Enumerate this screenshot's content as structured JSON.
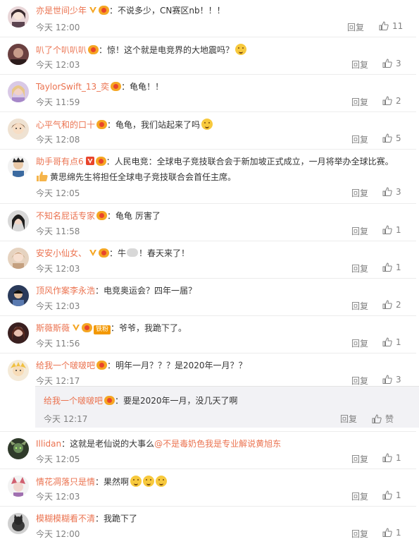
{
  "reply_label": "回复",
  "comments": [
    {
      "nick": "亦是世间少年",
      "text": "：不说多少，CN赛区nb！！！",
      "time": "今天 12:00",
      "likes": "11"
    },
    {
      "nick": "叭了个叭叭叭",
      "text": "：惊！这个就是电竞界的大地震吗？",
      "time": "今天 12:03",
      "likes": "3"
    },
    {
      "nick": "TaylorSwift_13_奕",
      "text": "：龟龟！！",
      "time": "今天 11:59",
      "likes": "2"
    },
    {
      "nick": "心平气和的口十",
      "text": "：龟龟，我们站起来了吗",
      "time": "今天 12:08",
      "likes": "5"
    },
    {
      "nick": "助手哥有点6",
      "text": "：人民电竞：全球电子竞技联合会于新加坡正式成立，一月将举办全球比赛。",
      "text2": "黄思绵先生将担任全球电子竞技联合会首任主席。",
      "time": "今天 12:05",
      "likes": "3"
    },
    {
      "nick": "不知名屁话专家",
      "text": "：龟龟 厉害了",
      "time": "今天 11:58",
      "likes": "1"
    },
    {
      "nick": "安安小仙女、",
      "text_a": "：牛",
      "text_b": "！春天来了！",
      "time": "今天 12:03",
      "likes": "1"
    },
    {
      "nick": "顶风作案李永浩",
      "text": "：电竞奥运会？四年一届？",
      "time": "今天 12:03",
      "likes": "2"
    },
    {
      "nick": "斯薇斯薇",
      "badge": "铁粉",
      "text": "：爷爷，我跪下了。",
      "time": "今天 11:56",
      "likes": "1"
    },
    {
      "nick": "给我一个啵啵吧",
      "text": "：明年一月？？？是2020年一月？？",
      "time": "今天 12:17",
      "likes": "3"
    },
    {
      "nick": "Illidan",
      "text_pre": "：这就是老仙说的大事么",
      "mention": "@不是毒奶色我是专业解说黄旭东",
      "time": "今天 12:05",
      "likes": "1"
    },
    {
      "nick": "情花凋落只是情",
      "text": "：果然啊",
      "time": "今天 12:03",
      "likes": "1"
    },
    {
      "nick": "模糊模糊看不清",
      "text": "：我跪下了",
      "time": "今天 12:00",
      "likes": "1"
    }
  ],
  "sub_reply": {
    "nick": "给我一个啵啵吧",
    "text": "：要是2020年一月，没几天了啊",
    "time": "今天 12:17",
    "like_label": "赞"
  },
  "colors": {
    "nick": "#eb7350",
    "meta": "#808080",
    "text": "#333333",
    "sub_bg": "#f2f2f5"
  }
}
